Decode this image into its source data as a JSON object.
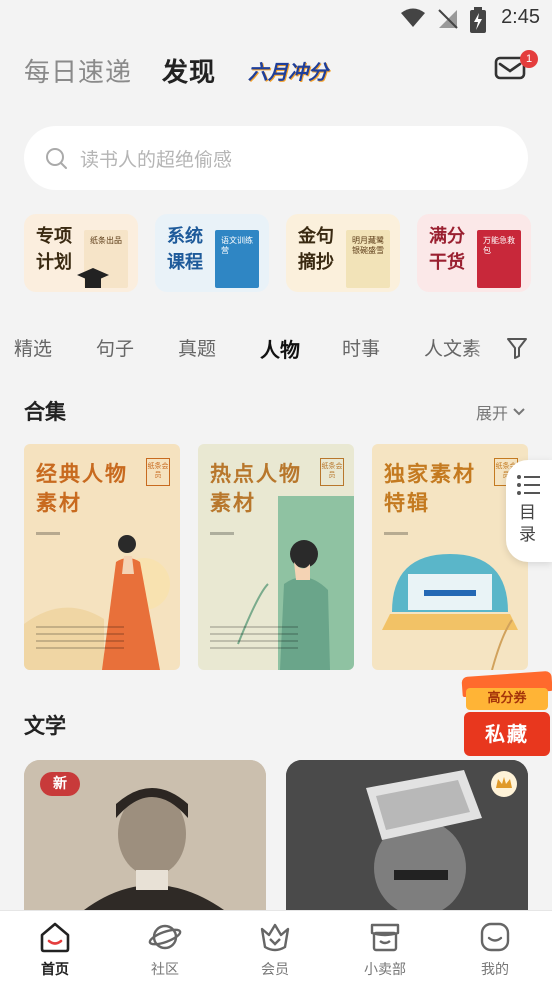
{
  "status": {
    "time": "2:45"
  },
  "header": {
    "tabs": [
      {
        "label": "每日速递"
      },
      {
        "label": "发现"
      },
      {
        "label": "六月冲分"
      }
    ],
    "mail_badge": "1"
  },
  "search": {
    "placeholder": "读书人的超绝偷感"
  },
  "features": [
    {
      "label": "专项计划",
      "book_text": "纸条出品",
      "bg": "#fbeede",
      "book_color": "#f6e4c8"
    },
    {
      "label": "系统课程",
      "book_text": "语文训练营",
      "bg": "#e9f2f8",
      "book_color": "#2f86c4"
    },
    {
      "label": "金句摘抄",
      "book_text": "明月藏鹭 银碗盛雪",
      "bg": "#fbf0dc",
      "book_color": "#f2e3b8"
    },
    {
      "label": "满分干货",
      "book_text": "万能急救包",
      "bg": "#fbe8e8",
      "book_color": "#c8283a"
    }
  ],
  "categories": [
    "精选",
    "句子",
    "真题",
    "人物",
    "时事",
    "人文素"
  ],
  "active_category": "人物",
  "collections_section": {
    "title": "合集",
    "expand": "展开"
  },
  "collections": [
    {
      "title": "经典人物素材",
      "seal": "纸条会员",
      "bg": "#f5e2bf",
      "accent": "#d9792e",
      "text_color": "#c86a1f"
    },
    {
      "title": "热点人物素材",
      "seal": "纸条会员",
      "bg": "#e9e8d2",
      "accent": "#7aab8c",
      "text_color": "#b8772c"
    },
    {
      "title": "独家素材特辑",
      "seal": "纸条会员",
      "bg": "#f5e4c2",
      "accent": "#5ab6c9",
      "text_color": "#c47a20"
    }
  ],
  "side_index": {
    "label": "目录"
  },
  "promo": {
    "top": "高分券",
    "bottom": "私藏"
  },
  "literature_section": {
    "title": "文学"
  },
  "literature": [
    {
      "badge": "新"
    },
    {
      "badge": ""
    }
  ],
  "bottom_nav": [
    {
      "label": "首页",
      "icon": "home-icon",
      "active": true
    },
    {
      "label": "社区",
      "icon": "planet-icon",
      "active": false
    },
    {
      "label": "会员",
      "icon": "vip-crown-icon",
      "active": false
    },
    {
      "label": "小卖部",
      "icon": "shop-icon",
      "active": false
    },
    {
      "label": "我的",
      "icon": "profile-icon",
      "active": false
    }
  ]
}
